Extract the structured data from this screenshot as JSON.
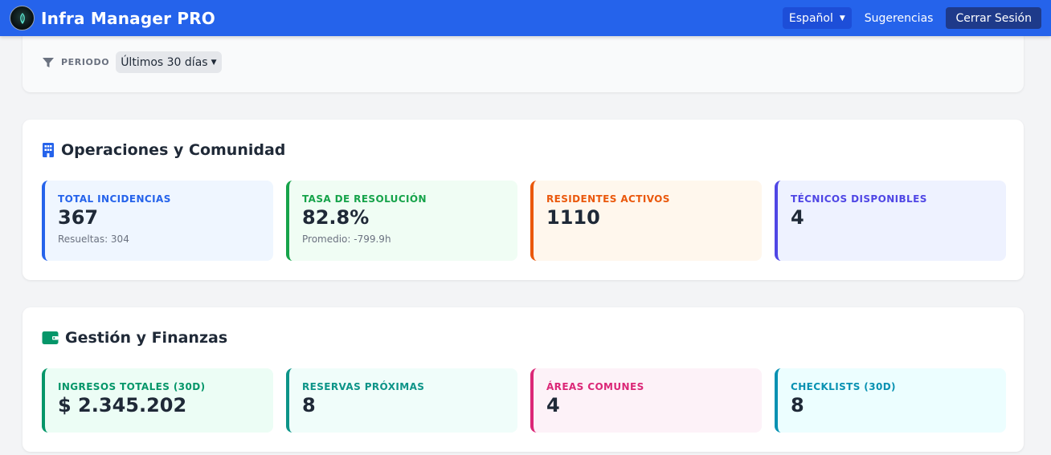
{
  "header": {
    "app_title": "Infra Manager PRO",
    "language": "Español",
    "suggestions": "Sugerencias",
    "logout": "Cerrar Sesión"
  },
  "filter": {
    "label": "PERIODO",
    "period": "Últimos 30 días"
  },
  "operations": {
    "title": "Operaciones y Comunidad",
    "cards": [
      {
        "label": "TOTAL INCIDENCIAS",
        "value": "367",
        "sub": "Resueltas: 304",
        "color": "#2563eb",
        "bg": "#eff6ff"
      },
      {
        "label": "TASA DE RESOLUCIÓN",
        "value": "82.8%",
        "sub": "Promedio: -799.9h",
        "color": "#16a34a",
        "bg": "#f0fdf4"
      },
      {
        "label": "RESIDENTES ACTIVOS",
        "value": "1110",
        "sub": "",
        "color": "#ea580c",
        "bg": "#fff7ed"
      },
      {
        "label": "TÉCNICOS DISPONIBLES",
        "value": "4",
        "sub": "",
        "color": "#4f46e5",
        "bg": "#eef2ff"
      }
    ]
  },
  "finance": {
    "title": "Gestión y Finanzas",
    "cards": [
      {
        "label": "INGRESOS TOTALES (30D)",
        "value": "$ 2.345.202",
        "color": "#059669",
        "bg": "#ecfdf5"
      },
      {
        "label": "RESERVAS PRÓXIMAS",
        "value": "8",
        "color": "#0d9488",
        "bg": "#f0fdfa"
      },
      {
        "label": "ÁREAS COMUNES",
        "value": "4",
        "color": "#db2777",
        "bg": "#fdf2f8"
      },
      {
        "label": "CHECKLISTS (30D)",
        "value": "8",
        "color": "#0891b2",
        "bg": "#ecfeff"
      }
    ]
  },
  "colors": {
    "topbar": "#2563eb",
    "ops_icon": "#2563eb",
    "fin_icon": "#059669"
  },
  "icons": {
    "filter": "filter-icon",
    "operations": "building-icon",
    "finance": "wallet-icon"
  }
}
